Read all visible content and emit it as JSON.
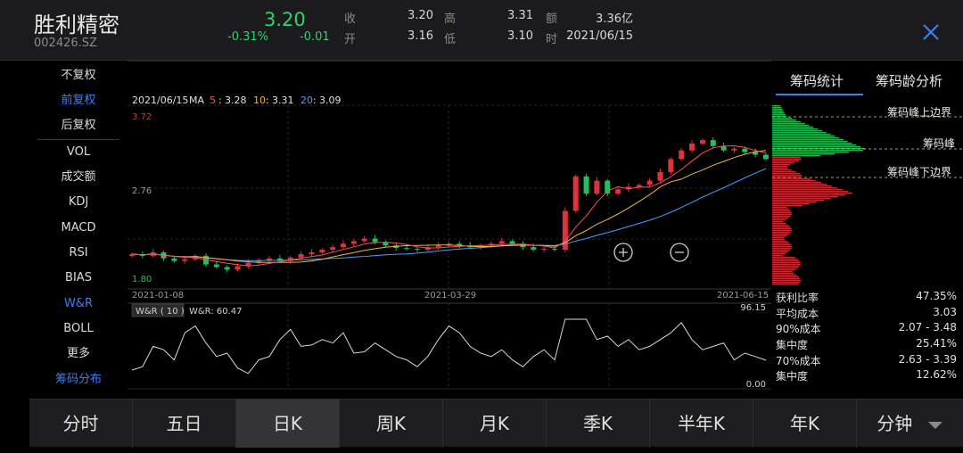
{
  "header": {
    "stock_name": "胜利精密",
    "stock_code": "002426.SZ",
    "price": "3.20",
    "change_pct": "-0.31%",
    "change_abs": "-0.01",
    "quote": [
      {
        "label": "收",
        "value": "3.20"
      },
      {
        "label": "高",
        "value": "3.31"
      },
      {
        "label": "额",
        "value": "3.36亿"
      },
      {
        "label": "开",
        "value": "3.16"
      },
      {
        "label": "低",
        "value": "3.10"
      },
      {
        "label": "时",
        "value": "2021/06/15"
      }
    ]
  },
  "menu": {
    "items": [
      "不复权",
      "前复权",
      "后复权",
      "VOL",
      "成交额",
      "KDJ",
      "MACD",
      "RSI",
      "BIAS",
      "W&R",
      "BOLL",
      "更多",
      "筹码分布"
    ],
    "active": [
      "前复权",
      "W&R",
      "筹码分布"
    ]
  },
  "ma": {
    "date": "2021/06/15",
    "label": "MA",
    "items": [
      {
        "period": "5",
        "value": "3.28",
        "color": "#ff4d5a"
      },
      {
        "period": "10",
        "value": "3.31",
        "color": "#f0b832"
      },
      {
        "period": "20",
        "value": "3.09",
        "color": "#3fa3ff"
      }
    ]
  },
  "axis": {
    "price_high": "3.72",
    "price_mid": "2.76",
    "price_low": "1.80",
    "dates": [
      "2021-01-08",
      "2021-03-29",
      "2021-06-15"
    ]
  },
  "wr": {
    "label": "W&R ( 10 )",
    "value_label": "W&R: 60.47",
    "top": "96.15",
    "bottom": "0.00"
  },
  "chart_data": {
    "type": "candlestick",
    "x_range": [
      "2021-01-08",
      "2021-06-15"
    ],
    "price_range": [
      1.8,
      3.72
    ],
    "last": {
      "open": 3.16,
      "high": 3.31,
      "low": 3.1,
      "close": 3.2
    },
    "ma": {
      "MA5": 3.28,
      "MA10": 3.31,
      "MA20": 3.09
    },
    "close_path": [
      2.1,
      2.08,
      2.12,
      2.05,
      2.02,
      2.04,
      2.08,
      1.98,
      1.95,
      1.92,
      1.96,
      2.0,
      2.03,
      2.05,
      2.02,
      2.06,
      2.1,
      2.12,
      2.15,
      2.18,
      2.22,
      2.25,
      2.28,
      2.24,
      2.2,
      2.17,
      2.16,
      2.15,
      2.18,
      2.2,
      2.22,
      2.2,
      2.18,
      2.2,
      2.22,
      2.25,
      2.22,
      2.18,
      2.15,
      2.16,
      2.15,
      2.6,
      3.0,
      2.8,
      2.95,
      2.8,
      2.85,
      2.88,
      2.9,
      2.95,
      3.05,
      3.2,
      3.3,
      3.38,
      3.42,
      3.35,
      3.3,
      3.32,
      3.28,
      3.25,
      3.2
    ],
    "wr_series": [
      75,
      70,
      40,
      45,
      60,
      20,
      10,
      35,
      55,
      50,
      72,
      80,
      60,
      55,
      30,
      15,
      40,
      38,
      30,
      35,
      20,
      50,
      48,
      35,
      45,
      55,
      60,
      70,
      55,
      30,
      10,
      20,
      40,
      50,
      55,
      45,
      60,
      70,
      55,
      45,
      60,
      0,
      0,
      0,
      30,
      25,
      40,
      30,
      45,
      40,
      30,
      20,
      5,
      30,
      45,
      40,
      35,
      60,
      50,
      55,
      60.47
    ]
  },
  "right_panel": {
    "tabs": [
      "筹码统计",
      "筹码龄分析"
    ],
    "active_tab": "筹码统计",
    "labels": {
      "upper": "筹码峰上边界",
      "peak": "筹码峰",
      "lower": "筹码峰下边界"
    },
    "stats": [
      {
        "label": "获利比率",
        "value": "47.35%"
      },
      {
        "label": "平均成本",
        "value": "3.03"
      },
      {
        "label": "90%成本",
        "value": "2.07 - 3.48"
      },
      {
        "label": "集中度",
        "value": "25.41%"
      },
      {
        "label": "70%成本",
        "value": "2.63 - 3.39"
      },
      {
        "label": "集中度",
        "value": "12.62%"
      }
    ]
  },
  "bottom_tabs": {
    "items": [
      "分时",
      "五日",
      "日K",
      "周K",
      "月K",
      "季K",
      "半年K",
      "年K",
      "分钟"
    ],
    "active": "日K"
  },
  "colors": {
    "up": "#e0323c",
    "down": "#20c05c",
    "accent": "#3d7ef6"
  }
}
